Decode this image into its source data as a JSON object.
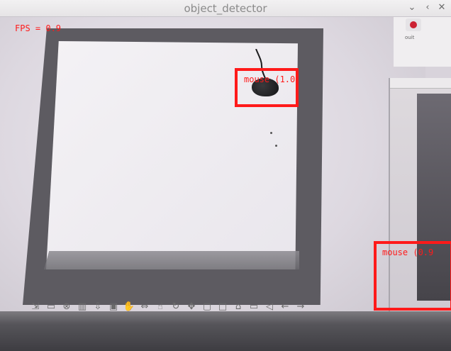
{
  "window": {
    "title": "object_detector",
    "chevron_glyph": "⌄",
    "prev_glyph": "‹",
    "close_glyph": "✕"
  },
  "overlay": {
    "fps_label": "FPS = 0.9",
    "color": "#ff1a1a",
    "detections": [
      {
        "label": "mouse (1.0)"
      },
      {
        "label": "mouse (0.9"
      }
    ]
  },
  "top_right_app": {
    "label": "ouit"
  },
  "toolbar": {
    "icons": [
      {
        "name": "exit-icon",
        "glyph": "⇲"
      },
      {
        "name": "window-icon",
        "glyph": "▭"
      },
      {
        "name": "stop-icon",
        "glyph": "⊗"
      },
      {
        "name": "trash-icon",
        "glyph": "▥"
      },
      {
        "name": "download-icon",
        "glyph": "⇩"
      },
      {
        "name": "monitor-icon",
        "glyph": "▣"
      },
      {
        "name": "hand-icon",
        "glyph": "✋"
      },
      {
        "name": "double-arrow-icon",
        "glyph": "⇔"
      },
      {
        "name": "hand-pointer-icon",
        "glyph": "☝"
      },
      {
        "name": "rotate-icon",
        "glyph": "↻"
      },
      {
        "name": "move-icon",
        "glyph": "✥"
      },
      {
        "name": "box-icon",
        "glyph": "▢"
      },
      {
        "name": "square-icon",
        "glyph": "□"
      },
      {
        "name": "home-icon",
        "glyph": "⌂"
      },
      {
        "name": "panel-icon",
        "glyph": "▭"
      },
      {
        "name": "back-faint-icon",
        "glyph": "◁"
      },
      {
        "name": "arrow-left-icon",
        "glyph": "←"
      },
      {
        "name": "arrow-right-icon",
        "glyph": "→"
      }
    ]
  }
}
